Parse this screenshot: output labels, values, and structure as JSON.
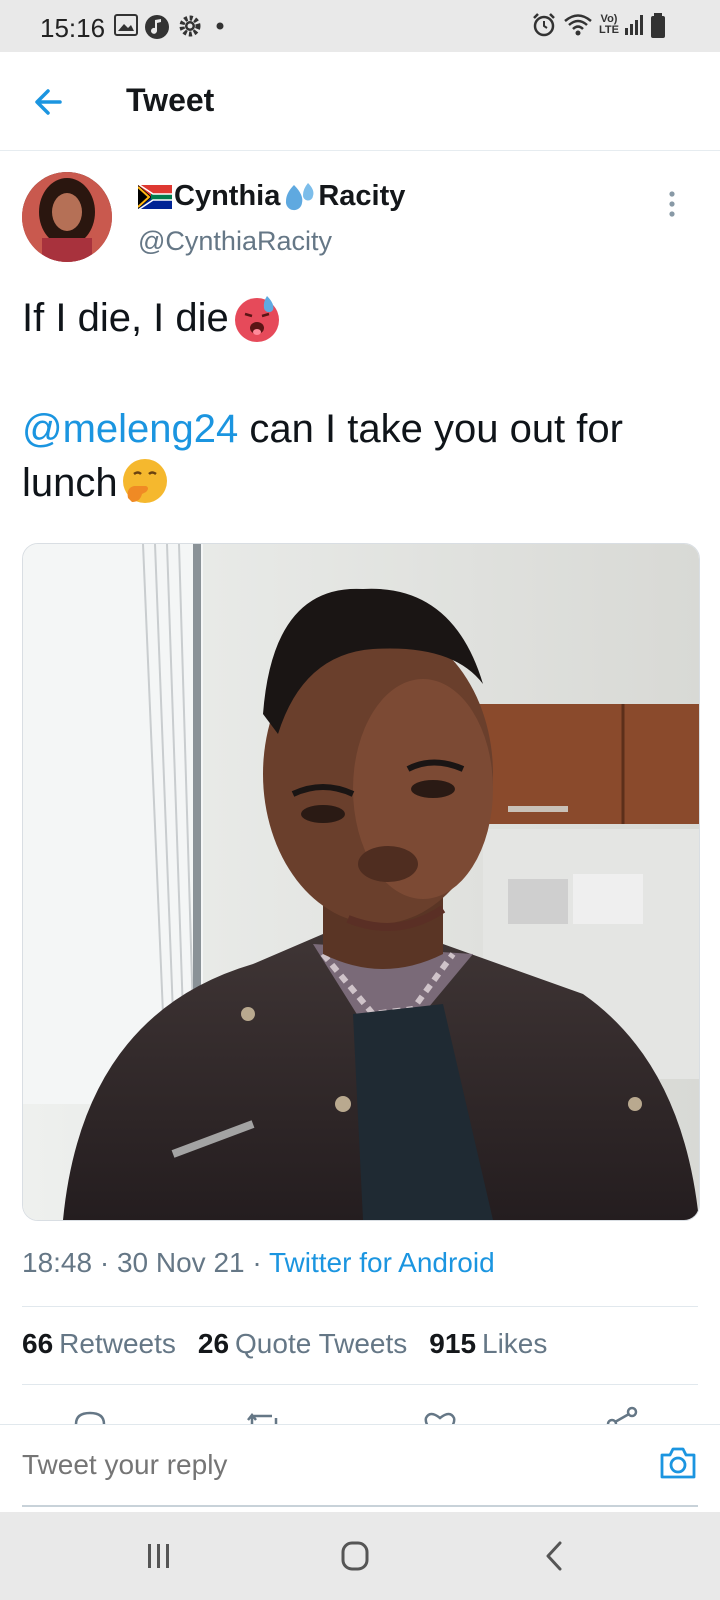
{
  "status_bar": {
    "time": "15:16",
    "left_icons": [
      "image-icon",
      "music-icon",
      "gear-icon",
      "dot-icon"
    ],
    "right_icons": [
      "alarm-icon",
      "wifi-icon",
      "volte-icon",
      "signal-icon",
      "battery-icon"
    ],
    "volte_label": "Vo) LTE"
  },
  "header": {
    "title": "Tweet",
    "back_icon": "arrow-left-icon"
  },
  "tweet": {
    "author_flag": "flag-south-africa-icon",
    "author_first": "Cynthia",
    "author_emoji": "sweat-droplets-icon",
    "author_last": "Racity",
    "handle": "@CynthiaRacity",
    "line1": "If I die, I die",
    "line1_emoji": "hot-face-icon",
    "mention": "@meleng24",
    "line2_rest": " can I take you out for lunch",
    "line2_emoji": "hand-over-mouth-icon",
    "time": "18:48",
    "date": "30 Nov 21",
    "source": "Twitter for Android",
    "retweets_count": "66",
    "retweets_label": "Retweets",
    "quotes_count": "26",
    "quotes_label": "Quote Tweets",
    "likes_count": "915",
    "likes_label": "Likes"
  },
  "actions": [
    "reply-icon",
    "retweet-icon",
    "like-icon",
    "share-icon"
  ],
  "reply": {
    "placeholder": "Tweet your reply",
    "camera_icon": "camera-icon"
  },
  "nav": [
    "recent-apps-icon",
    "home-icon",
    "back-icon"
  ],
  "colors": {
    "accent": "#1b95e0",
    "secondary_text": "#657786",
    "system_bar": "#e9e9e9"
  }
}
